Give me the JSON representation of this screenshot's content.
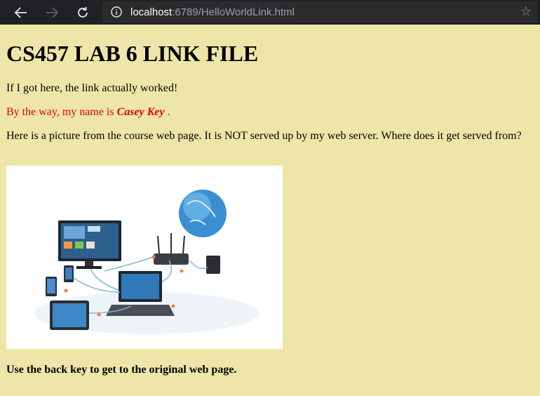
{
  "browser": {
    "url_host": "localhost",
    "url_rest": ":6789/HelloWorldLink.html",
    "icons": [
      "back-arrow-icon",
      "forward-arrow-icon",
      "reload-icon",
      "info-icon",
      "star-icon"
    ]
  },
  "content": {
    "heading": "CS457 LAB 6 LINK FILE",
    "para1": "If I got here, the link actually worked!",
    "para2_prefix": "By the way, my name is ",
    "para2_name": "Casey Key",
    "para2_suffix": " .",
    "para3": "Here is a picture from the course web page. It is NOT served up by my web server. Where does it get served from?",
    "image_subject": "network-devices-illustration",
    "para4": "Use the back key to get to the original web page."
  },
  "colors": {
    "page_background": "#eee6a9",
    "toolbar": "#202124",
    "name_text": "#e00000"
  }
}
